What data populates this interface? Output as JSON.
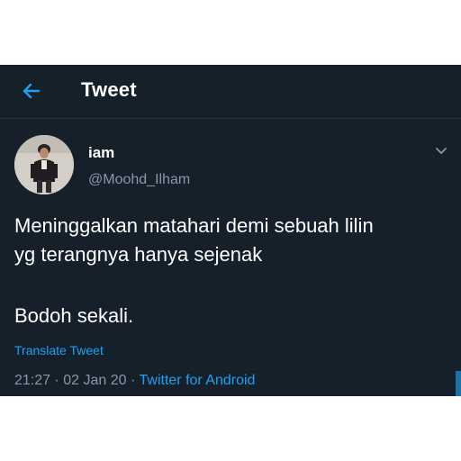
{
  "header": {
    "back_icon": "arrow-left-icon",
    "title": "Tweet"
  },
  "tweet": {
    "author": {
      "name": "iam",
      "handle": "@Moohd_Ilham"
    },
    "menu_icon": "chevron-down-icon",
    "text_lines": [
      "Meninggalkan matahari demi sebuah lilin",
      "yg terangnya hanya sejenak",
      "Bodoh sekali."
    ],
    "translate_label": "Translate Tweet",
    "time": "21:27",
    "date": "02 Jan 20",
    "separator": "·",
    "source": "Twitter for Android"
  },
  "colors": {
    "background": "#15202b",
    "accent": "#1da1f2",
    "secondary_text": "#8899a6"
  }
}
